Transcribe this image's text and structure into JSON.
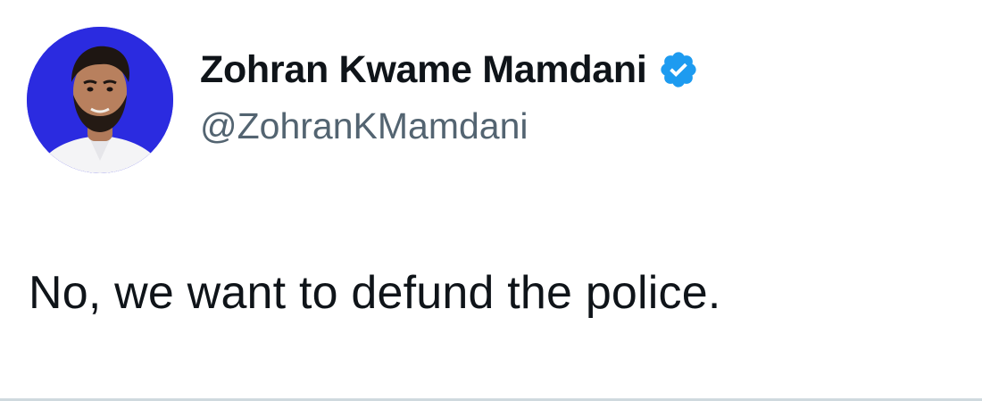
{
  "tweet": {
    "author": {
      "display_name": "Zohran Kwame Mamdani",
      "handle": "@ZohranKMamdani",
      "verified": true,
      "avatar_icon": "profile-photo"
    },
    "text": "No, we want to defund the police."
  },
  "colors": {
    "name_text": "#0f1419",
    "handle_text": "#536471",
    "verified_badge": "#1d9bf0",
    "avatar_background": "#2b2be0",
    "divider": "#cfd9de"
  }
}
